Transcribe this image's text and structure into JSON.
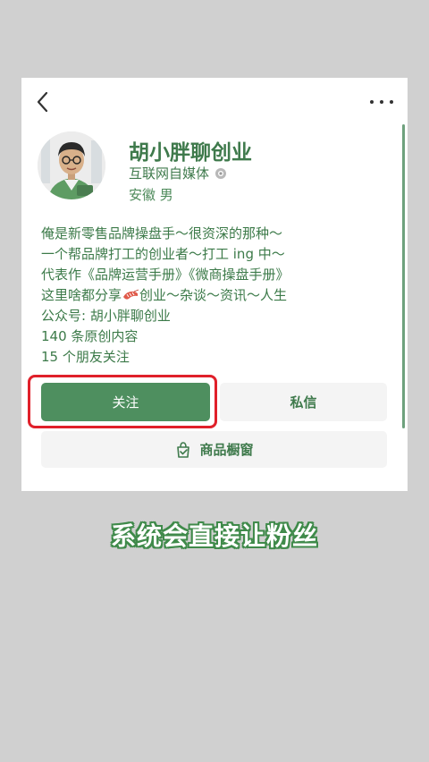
{
  "header": {
    "back_icon": "chevron-left-icon",
    "more_icon": "more-dots-icon"
  },
  "profile": {
    "name": "胡小胖聊创业",
    "tag": "互联网自媒体",
    "tag_badge_icon": "verified-badge-icon",
    "location": "安徽 男",
    "avatar_icon": "cartoon-avatar"
  },
  "bio": {
    "lines": [
      "俺是新零售品牌操盘手～很资深的那种～",
      "一个帮品牌打工的创业者～打工 ing 中～",
      "代表作《品牌运营手册》《微商操盘手册》"
    ],
    "share_prefix": "这里啥都分享",
    "share_emoji": "shrimp-emoji",
    "share_suffix": "创业～杂谈～资讯～人生",
    "official_account": "公众号: 胡小胖聊创业",
    "original_count": "140 条原创内容",
    "friends_follow": "15 个朋友关注"
  },
  "actions": {
    "follow_label": "关注",
    "message_label": "私信",
    "shop_label": "商品橱窗",
    "shop_icon": "shopping-bag-icon"
  },
  "caption": "系统会直接让粉丝",
  "colors": {
    "brand_green": "#4e8f5f",
    "text_green": "#3f7a4c",
    "highlight_red": "#e0202a",
    "background": "#d0d0d0"
  }
}
